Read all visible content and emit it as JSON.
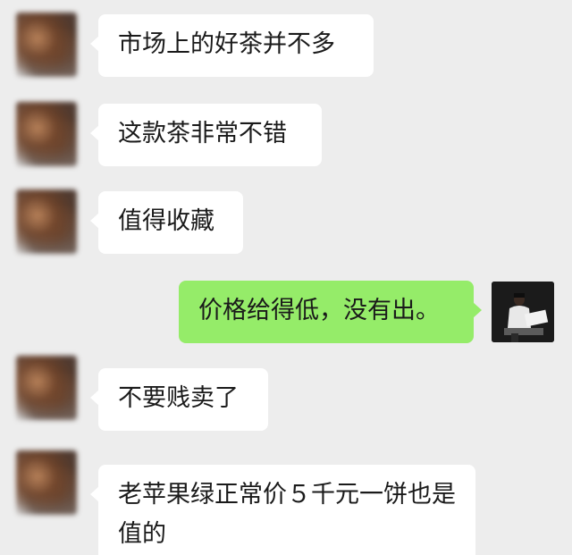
{
  "chat": {
    "messages": [
      {
        "side": "left",
        "text": "市场上的好茶并不多"
      },
      {
        "side": "left",
        "text": "这款茶非常不错"
      },
      {
        "side": "left",
        "text": "值得收藏"
      },
      {
        "side": "right",
        "text": "价格给得低，没有出。"
      },
      {
        "side": "left",
        "text": "不要贱卖了"
      },
      {
        "side": "left",
        "text": "老苹果绿正常价５千元一饼也是值的"
      }
    ]
  },
  "colors": {
    "background": "#ededed",
    "incoming_bubble": "#ffffff",
    "outgoing_bubble": "#95ec69"
  },
  "icons": {
    "left_avatar": "blurred-avatar",
    "right_avatar": "user-photo-avatar"
  }
}
